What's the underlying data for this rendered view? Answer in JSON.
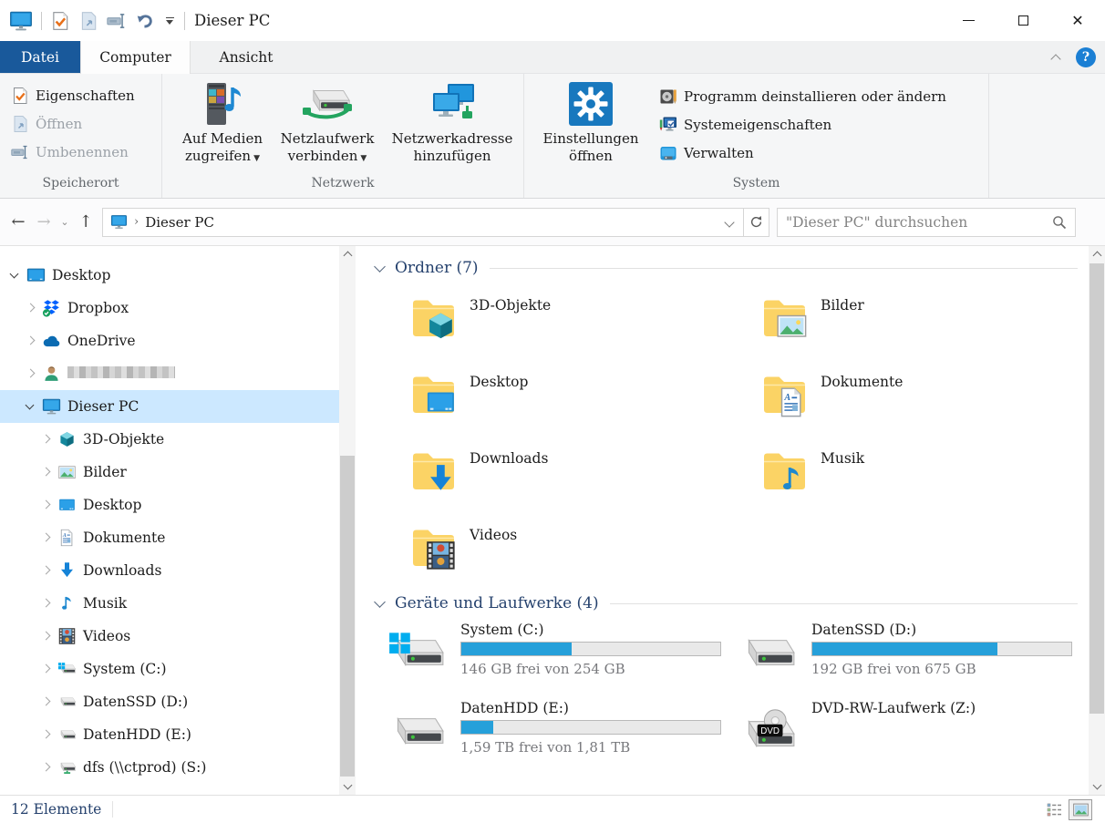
{
  "titlebar": {
    "title": "Dieser PC"
  },
  "tabs": {
    "file": "Datei",
    "computer": "Computer",
    "view": "Ansicht"
  },
  "ribbon": {
    "groups": [
      {
        "label": "Speicherort",
        "items": [
          {
            "label": "Eigenschaften",
            "icon": "properties",
            "enabled": true
          },
          {
            "label": "Öffnen",
            "icon": "open-page",
            "enabled": false
          },
          {
            "label": "Umbenennen",
            "icon": "rename",
            "enabled": false
          }
        ]
      },
      {
        "label": "Netzwerk",
        "items": [
          {
            "label": "Auf Medien zugreifen",
            "icon": "media-server",
            "dropdown": true
          },
          {
            "label": "Netzlaufwerk verbinden",
            "icon": "net-drive-connect",
            "dropdown": true
          },
          {
            "label": "Netzwerkadresse hinzufügen",
            "icon": "network-add",
            "dropdown": false
          }
        ]
      },
      {
        "label": "System",
        "big": {
          "label": "Einstellungen öffnen",
          "icon": "settings-gear"
        },
        "items": [
          {
            "label": "Programm deinstallieren oder ändern",
            "icon": "uninstall"
          },
          {
            "label": "Systemeigenschaften",
            "icon": "sysprops"
          },
          {
            "label": "Verwalten",
            "icon": "manage"
          }
        ]
      }
    ]
  },
  "navbar": {
    "breadcrumb_root": "Dieser PC",
    "search_placeholder": "\"Dieser PC\" durchsuchen"
  },
  "tree": {
    "items": [
      {
        "label": "Desktop",
        "icon": "desktop-monitor",
        "depth": 0,
        "expanded": true
      },
      {
        "label": "Dropbox",
        "icon": "dropbox",
        "depth": 1
      },
      {
        "label": "OneDrive",
        "icon": "onedrive",
        "depth": 1
      },
      {
        "label": "",
        "icon": "user",
        "depth": 1,
        "redacted": true
      },
      {
        "label": "Dieser PC",
        "icon": "this-pc",
        "depth": 1,
        "expanded": true,
        "selected": true
      },
      {
        "label": "3D-Objekte",
        "icon": "cube",
        "depth": 2
      },
      {
        "label": "Bilder",
        "icon": "picture",
        "depth": 2
      },
      {
        "label": "Desktop",
        "icon": "desktop",
        "depth": 2
      },
      {
        "label": "Dokumente",
        "icon": "document",
        "depth": 2
      },
      {
        "label": "Downloads",
        "icon": "download",
        "depth": 2
      },
      {
        "label": "Musik",
        "icon": "music",
        "depth": 2
      },
      {
        "label": "Videos",
        "icon": "film",
        "depth": 2
      },
      {
        "label": "System (C:)",
        "icon": "drive-windows",
        "depth": 2
      },
      {
        "label": "DatenSSD (D:)",
        "icon": "drive",
        "depth": 2
      },
      {
        "label": "DatenHDD (E:)",
        "icon": "drive",
        "depth": 2
      },
      {
        "label": "dfs (\\\\ctprod) (S:)",
        "icon": "network-drive",
        "depth": 2
      }
    ]
  },
  "main": {
    "folders_section": {
      "title": "Ordner (7)"
    },
    "folders": [
      {
        "label": "3D-Objekte",
        "icon": "cube"
      },
      {
        "label": "Desktop",
        "icon": "desktop"
      },
      {
        "label": "Downloads",
        "icon": "download"
      },
      {
        "label": "Videos",
        "icon": "film"
      },
      {
        "label": "Bilder",
        "icon": "picture"
      },
      {
        "label": "Dokumente",
        "icon": "document"
      },
      {
        "label": "Musik",
        "icon": "music"
      }
    ],
    "drives_section": {
      "title": "Geräte und Laufwerke (4)"
    },
    "drives": [
      {
        "label": "System (C:)",
        "icon": "drive-windows",
        "free_text": "146 GB frei von 254 GB",
        "used_percent": 42.5
      },
      {
        "label": "DatenSSD (D:)",
        "icon": "drive",
        "free_text": "192 GB frei von 675 GB",
        "used_percent": 71.6
      },
      {
        "label": "DatenHDD (E:)",
        "icon": "drive",
        "free_text": "1,59 TB frei von 1,81 TB",
        "used_percent": 12.2
      },
      {
        "label": "DVD-RW-Laufwerk (Z:)",
        "icon": "dvd"
      }
    ]
  },
  "statusbar": {
    "count_label": "12 Elemente"
  },
  "icon_badges": {
    "dvd": "DVD"
  },
  "colors": {
    "accent_tab": "#19599b",
    "selection": "#cce8ff",
    "usage_bar": "#26a0da",
    "section_header": "#26426e"
  }
}
